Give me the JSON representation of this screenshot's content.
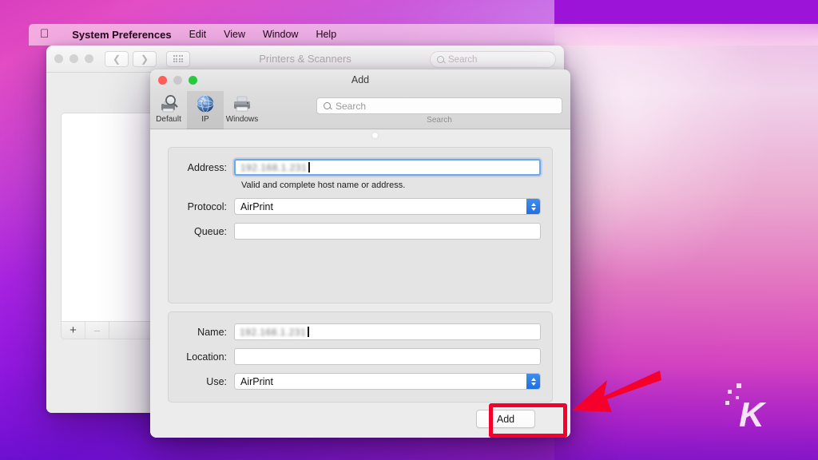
{
  "menubar": {
    "apple_icon": "apple-logo-icon",
    "items": [
      {
        "label": "System Preferences",
        "bold": true
      },
      {
        "label": "Edit",
        "bold": false
      },
      {
        "label": "View",
        "bold": false
      },
      {
        "label": "Window",
        "bold": false
      },
      {
        "label": "Help",
        "bold": false
      }
    ]
  },
  "prefs_window": {
    "title": "Printers & Scanners",
    "search_placeholder": "Search",
    "search_icon": "search-icon",
    "back_icon": "chevron-left-icon",
    "forward_icon": "chevron-right-icon",
    "grid_icon": "grid-view-icon",
    "list_add_label": "+",
    "list_remove_label": "–"
  },
  "add_dialog": {
    "title": "Add",
    "toolbar": {
      "tabs": [
        {
          "label": "Default",
          "icon": "default-printer-icon",
          "selected": false
        },
        {
          "label": "IP",
          "icon": "ip-globe-icon",
          "selected": true
        },
        {
          "label": "Windows",
          "icon": "windows-printer-icon",
          "selected": false
        }
      ],
      "search_placeholder": "Search",
      "search_icon": "search-icon",
      "search_caption": "Search"
    },
    "top_section": {
      "address_label": "Address:",
      "address_value": "192.168.1.231",
      "address_redacted": true,
      "address_hint": "Valid and complete host name or address.",
      "protocol_label": "Protocol:",
      "protocol_value": "AirPrint",
      "queue_label": "Queue:",
      "queue_value": ""
    },
    "bottom_section": {
      "name_label": "Name:",
      "name_value": "192.168.1.231",
      "name_redacted": true,
      "location_label": "Location:",
      "location_value": "",
      "use_label": "Use:",
      "use_value": "AirPrint"
    },
    "add_button_label": "Add"
  },
  "annotations": {
    "highlight_color": "#f5002d",
    "arrow_color": "#f5002d",
    "arrow_direction": "left",
    "watermark_letter": "K"
  }
}
